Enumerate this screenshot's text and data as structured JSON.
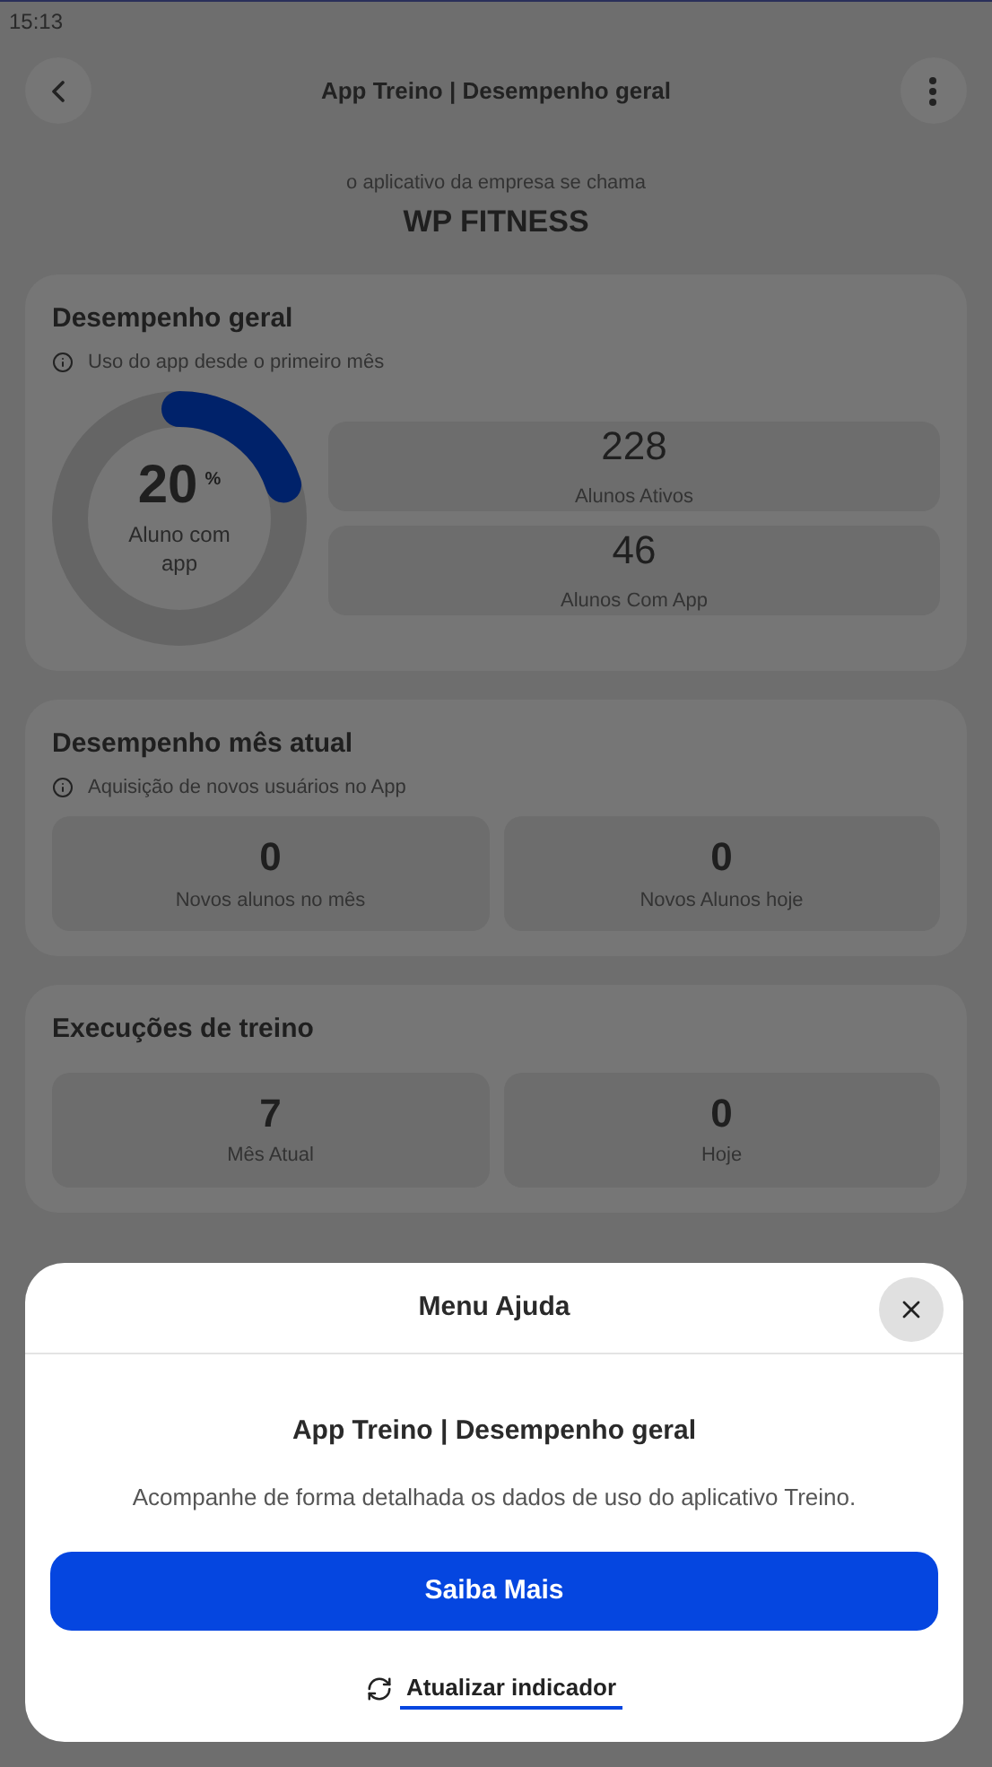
{
  "status_bar": {
    "time": "15:13"
  },
  "header": {
    "title": "App Treino | Desempenho geral"
  },
  "brand": {
    "caption": "o aplicativo da empresa se chama",
    "name": "WP FITNESS"
  },
  "sections": [
    {
      "kind": "donut",
      "title": "Desempenho geral",
      "info": "Uso do app desde o primeiro mês",
      "donut": {
        "value": "20",
        "unit": "%",
        "label": "Aluno com app",
        "level": 0.2
      },
      "stats": [
        {
          "value": "228",
          "label": "Alunos Ativos"
        },
        {
          "value": "46",
          "label": "Alunos Com App"
        }
      ]
    },
    {
      "kind": "tiles",
      "title": "Desempenho mês atual",
      "info": "Aquisição de novos usuários no App",
      "stats": [
        {
          "value": "0",
          "label": "Novos alunos no mês"
        },
        {
          "value": "0",
          "label": "Novos Alunos hoje"
        }
      ]
    },
    {
      "kind": "tiles",
      "title": "Execuções de treino",
      "stats": [
        {
          "value": "7",
          "label": "Mês Atual"
        },
        {
          "value": "0",
          "label": "Hoje"
        }
      ]
    }
  ],
  "help_sheet": {
    "title": "Menu Ajuda",
    "heading": "App Treino | Desempenho geral",
    "description": "Acompanhe de forma detalhada os dados de uso do aplicativo Treino.",
    "primary_button": "Saiba Mais",
    "link": "Atualizar indicador"
  }
}
